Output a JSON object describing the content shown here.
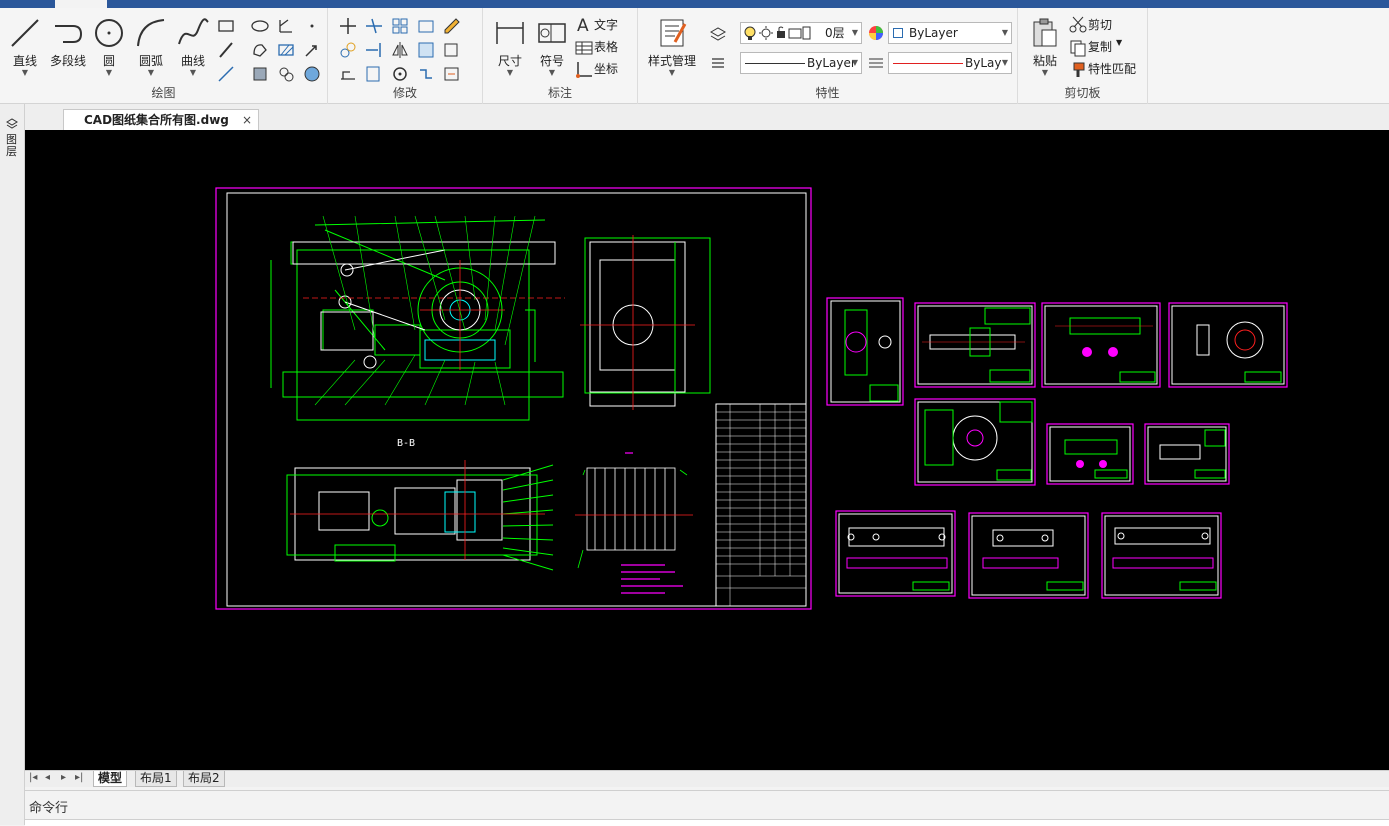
{
  "ribbon": {
    "draw": {
      "label": "绘图",
      "line": "直线",
      "polyline": "多段线",
      "circle": "圆",
      "arc": "圆弧",
      "curve": "曲线"
    },
    "modify": {
      "label": "修改"
    },
    "annotate": {
      "label": "标注",
      "dimension": "尺寸",
      "symbol": "符号",
      "text": "文字",
      "table": "表格",
      "coordinate": "坐标"
    },
    "properties": {
      "label": "特性",
      "style_manager": "样式管理",
      "layer": "0层",
      "color": "ByLayer",
      "linetype": "ByLayer",
      "lineweight": "ByLay"
    },
    "clipboard": {
      "label": "剪切板",
      "paste": "粘贴",
      "cut": "剪切",
      "copy": "复制",
      "match": "特性匹配"
    }
  },
  "side_panel": {
    "label": "图层"
  },
  "document": {
    "tab": "CAD图纸集合所有图.dwg",
    "close": "×"
  },
  "drawing": {
    "section_label": "B-B"
  },
  "layout_tabs": [
    "模型",
    "布局1",
    "布局2"
  ],
  "command": {
    "label": "命令行"
  },
  "colors": {
    "ribbon_blue": "#2b579a",
    "magenta": "#ff00ff",
    "green": "#00ff00",
    "red": "#ff2020",
    "cyan": "#00ffff",
    "yellow": "#ffff00"
  }
}
